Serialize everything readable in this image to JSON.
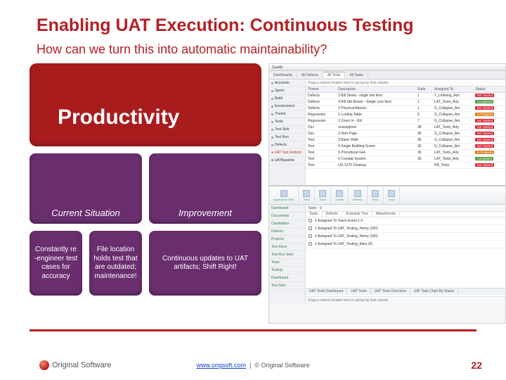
{
  "title": "Enabling UAT Execution: Continuous Testing",
  "subtitle": "How can we turn this into automatic maintainability?",
  "bigBox": "Productivity",
  "row1": [
    "Current Situation",
    "Improvement"
  ],
  "row2": [
    "Constantly  re -engineer test cases   for accuracy",
    "File location holds test that are outdated; maintenance!",
    "Continuous updates to UAT artifacts; Shift Right!"
  ],
  "app": {
    "title": "Qualify",
    "tabs": [
      "Dashboards",
      "All Defects",
      "All Tests",
      "All Tasks"
    ],
    "activeTab": 2,
    "filter": "Drag a column header here to group by that column",
    "sidebar": [
      "Accounts",
      "Sprint",
      "Build",
      "Environment",
      "Theme",
      "Tests",
      "Test Sets",
      "Test Run",
      "Defects"
    ],
    "defectsItem": "UAT Test Defects",
    "baselineItem": "UATBaseline",
    "columns": [
      "Theme",
      "Description",
      "Suite",
      "Assigned To",
      "Status"
    ],
    "rows": [
      [
        "Defects",
        "3 Bill Street - single line item",
        "1",
        "T_Leftwing_Ash",
        "Not Started"
      ],
      [
        "Defects",
        "4 Bill Strt Brown - Single Line Item",
        "1",
        "LAT_Tests_Arty",
        "Completed"
      ],
      [
        "Defects",
        "5 Physical Attacks",
        "1",
        "G_Collapse_Am",
        "Not Started"
      ],
      [
        "Regression",
        "1 Lookup Table",
        "5",
        "G_Collapse_Am",
        "In Progress"
      ],
      [
        "Regression",
        "2 Zoom In - Kid",
        "7",
        "G_Collapse_Am",
        "Not Started"
      ],
      [
        "Dev",
        "unassigned",
        "38",
        "LAT_Tests_Arty",
        "Not Started"
      ],
      [
        "Dev",
        "2 Item Page",
        "36",
        "G_Collapse_Am",
        "Not Started"
      ],
      [
        "Test",
        "3 Basic Walk",
        "36",
        "G_Collapse_Am",
        "Not Started"
      ],
      [
        "Test",
        "4 Single Building Scene",
        "36",
        "G_Collapse_Am",
        "Not Started"
      ],
      [
        "Test",
        "5 Procedural Gen",
        "36",
        "LAT_Tests_Arty",
        "In Progress"
      ],
      [
        "Test",
        "6 Combat System",
        "36",
        "LAT_Tests_Arty",
        "Completed"
      ],
      [
        "Test",
        "US-1276 Cleanup",
        "",
        "KB_Tests",
        "Not Started"
      ]
    ],
    "nav2": [
      "Dashboard",
      "Documents",
      "Candidates",
      "Defects",
      "Projects",
      "Test Runs",
      "Test Run Sets",
      "Tests",
      "Testing",
      "Dashboard",
      "Test Sets"
    ],
    "ribbon": [
      "Application View",
      "New",
      "Save",
      "Delete",
      "Refresh",
      "Print",
      "Help"
    ],
    "panelTabs": [
      "Tasks",
      "Defects",
      "Schedule Tree",
      "Attachments"
    ],
    "panelRows": [
      "1   Assigned To Teach Event 1.0",
      "1   Assigned To UAT_Testing_Henry (250)",
      "2   Assigned To UAT_Testing_Henry (250)",
      "2   Assigned To UAT_Testing_Mary (0)"
    ],
    "bottomTabs": [
      "UAT Tests Dashboard",
      "UAT Tests",
      "UAT Tests Overview",
      "UAT Task Chart By Status"
    ],
    "statusbar": "Drag a column header here to group by that column"
  },
  "footer": {
    "brand": "Original Software",
    "link": "www.origsoft.com",
    "copy": "© Original Software",
    "page": "22"
  },
  "statusColors": {
    "Not Started": "b-red",
    "Completed": "b-green",
    "In Progress": "b-orange"
  }
}
